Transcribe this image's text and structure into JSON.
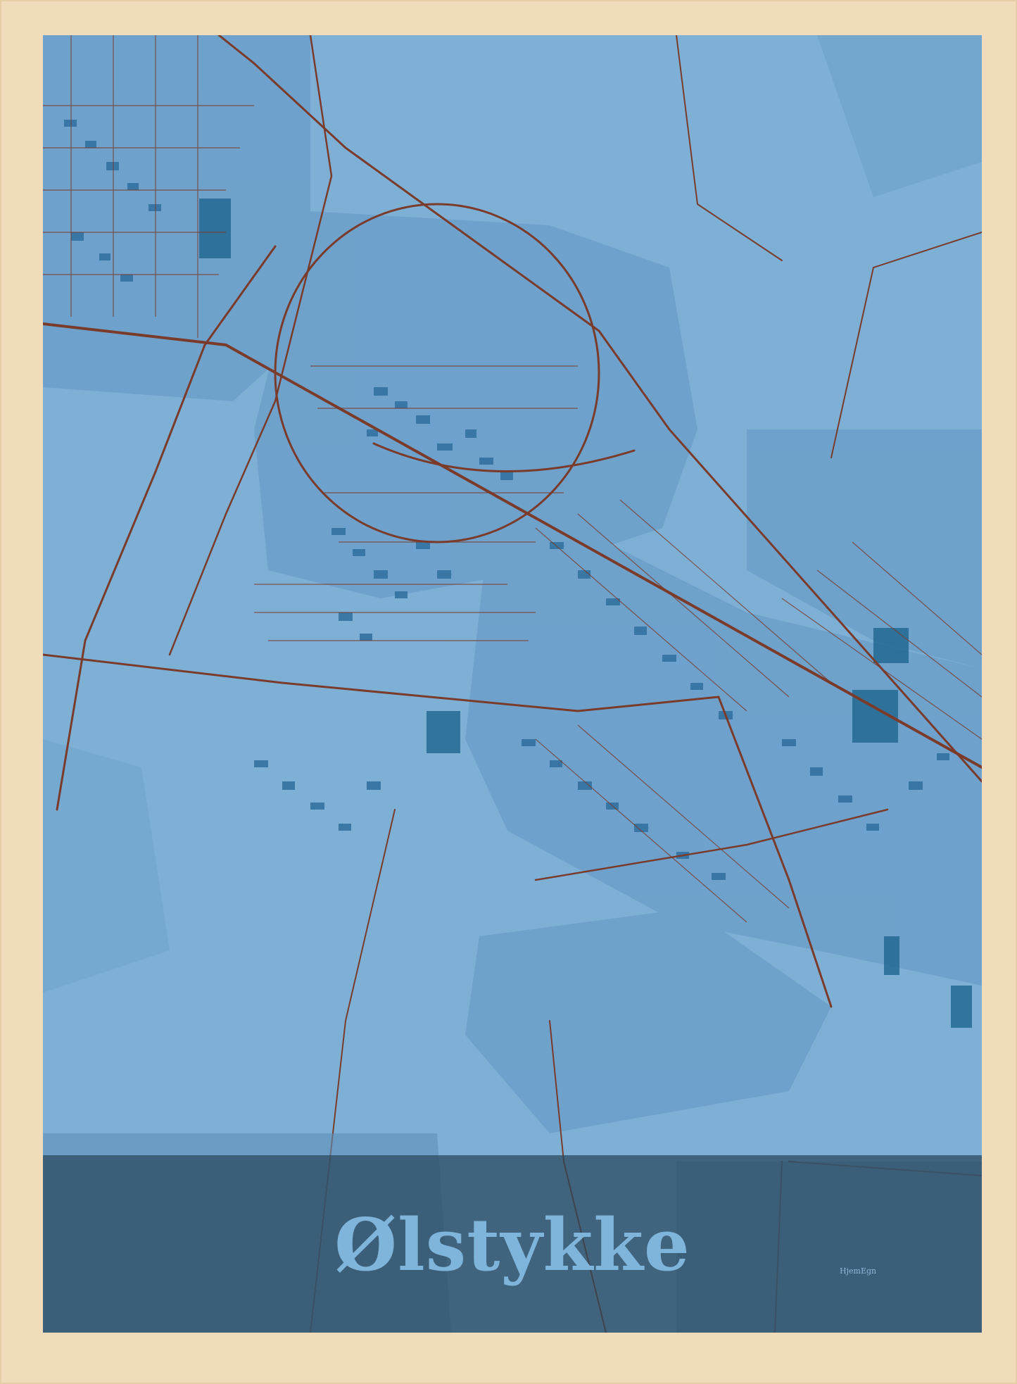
{
  "poster": {
    "title": "Ølstykke",
    "brand": "HjemEgn"
  },
  "colors": {
    "frame": "#f0dcba",
    "water_background": "#7eb0d6",
    "land_zones": "#6a9ec8",
    "buildings": "#2f6e9e",
    "large_buildings": "#236a93",
    "roads": "#7a3b2b",
    "banner": "#28465c",
    "title_text": "#80b5db"
  }
}
